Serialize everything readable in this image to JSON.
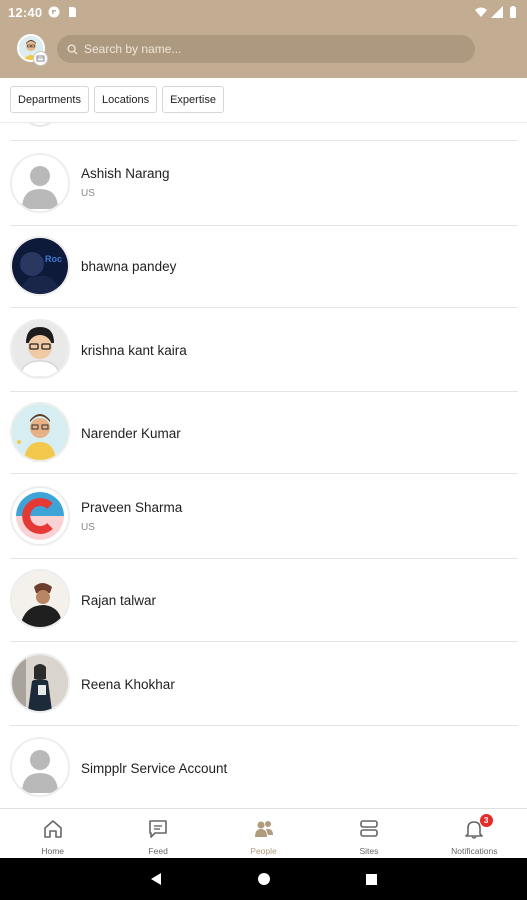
{
  "status_bar": {
    "time": "12:40"
  },
  "search": {
    "placeholder": "Search by name..."
  },
  "filters": [
    "Departments",
    "Locations",
    "Expertise"
  ],
  "people": [
    {
      "name": "Ashish Narang",
      "location": "US",
      "avatar": "default-person"
    },
    {
      "name": "bhawna pandey",
      "location": "",
      "avatar": "photo-dark"
    },
    {
      "name": "krishna kant kaira",
      "location": "",
      "avatar": "cartoon-glasses"
    },
    {
      "name": "Narender Kumar",
      "location": "",
      "avatar": "cartoon-yellow"
    },
    {
      "name": "Praveen Sharma",
      "location": "US",
      "avatar": "logo-c"
    },
    {
      "name": "Rajan talwar",
      "location": "",
      "avatar": "photo-person"
    },
    {
      "name": "Reena Khokhar",
      "location": "",
      "avatar": "photo-woman"
    },
    {
      "name": "Simpplr Service Account",
      "location": "",
      "avatar": "default-person"
    }
  ],
  "bottom_nav": {
    "items": [
      {
        "label": "Home",
        "icon": "home-icon",
        "active": false
      },
      {
        "label": "Feed",
        "icon": "feed-icon",
        "active": false
      },
      {
        "label": "People",
        "icon": "people-icon",
        "active": true
      },
      {
        "label": "Sites",
        "icon": "sites-icon",
        "active": false
      },
      {
        "label": "Notifications",
        "icon": "bell-icon",
        "active": false
      }
    ],
    "notification_count": "3"
  },
  "colors": {
    "header": "#c2ad93",
    "search_bg": "#ad997f",
    "accent": "#b19b7d",
    "badge": "#e52a2a"
  }
}
